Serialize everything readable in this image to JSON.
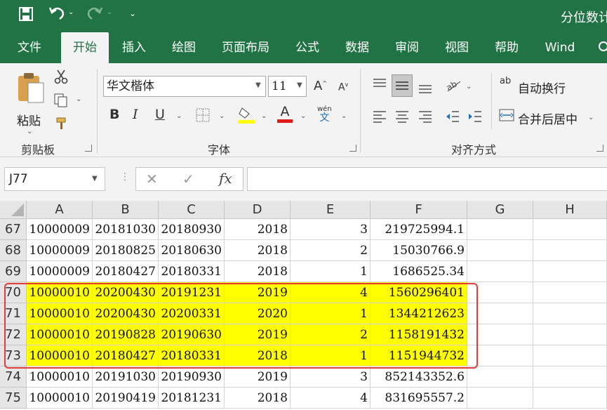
{
  "app": {
    "title": "分位数计"
  },
  "quick_access": {
    "save_icon": "save-icon",
    "undo_icon": "undo-icon",
    "redo_icon": "redo-icon",
    "customize_icon": "customize-qat-icon"
  },
  "tabs": [
    "文件",
    "开始",
    "插入",
    "绘图",
    "页面布局",
    "公式",
    "数据",
    "审阅",
    "视图",
    "帮助",
    "Wind"
  ],
  "active_tab": "开始",
  "ribbon": {
    "clipboard": {
      "paste_label": "粘贴",
      "group_label": "剪贴板"
    },
    "font": {
      "font_name": "华文楷体",
      "font_size": "11",
      "group_label": "字体",
      "bold": "B",
      "italic": "I",
      "underline": "U",
      "font_color_letter": "A",
      "grow_letter": "A",
      "shrink_letter": "A",
      "phonetic_top": "wén",
      "phonetic_bottom": "文",
      "highlight_color": "#ffff00",
      "font_color": "#e01b1b"
    },
    "alignment": {
      "wrap_text": "自动换行",
      "merge_center": "合并后居中",
      "group_label": "对齐方式",
      "wrap_glyph": "ab"
    }
  },
  "formula_bar": {
    "name_box": "J77",
    "cancel": "✕",
    "enter": "✓",
    "fx": "fx",
    "value": ""
  },
  "grid": {
    "columns": [
      "A",
      "B",
      "C",
      "D",
      "E",
      "F",
      "G",
      "H"
    ],
    "rows": [
      {
        "num": "67",
        "cells": [
          "10000009",
          "20181030",
          "20180930",
          "2018",
          "3",
          "219725994.1",
          "",
          ""
        ],
        "highlight": false
      },
      {
        "num": "68",
        "cells": [
          "10000009",
          "20180825",
          "20180630",
          "2018",
          "2",
          "15030766.9",
          "",
          ""
        ],
        "highlight": false
      },
      {
        "num": "69",
        "cells": [
          "10000009",
          "20180427",
          "20180331",
          "2018",
          "1",
          "1686525.34",
          "",
          ""
        ],
        "highlight": false
      },
      {
        "num": "70",
        "cells": [
          "10000010",
          "20200430",
          "20191231",
          "2019",
          "4",
          "1560296401",
          "",
          ""
        ],
        "highlight": true
      },
      {
        "num": "71",
        "cells": [
          "10000010",
          "20200430",
          "20200331",
          "2020",
          "1",
          "1344212623",
          "",
          ""
        ],
        "highlight": true
      },
      {
        "num": "72",
        "cells": [
          "10000010",
          "20190828",
          "20190630",
          "2019",
          "2",
          "1158191432",
          "",
          ""
        ],
        "highlight": true
      },
      {
        "num": "73",
        "cells": [
          "10000010",
          "20180427",
          "20180331",
          "2018",
          "1",
          "1151944732",
          "",
          ""
        ],
        "highlight": true
      },
      {
        "num": "74",
        "cells": [
          "10000010",
          "20191030",
          "20190930",
          "2019",
          "3",
          "852143352.6",
          "",
          ""
        ],
        "highlight": false
      },
      {
        "num": "75",
        "cells": [
          "10000010",
          "20190419",
          "20181231",
          "2018",
          "4",
          "831695557.2",
          "",
          ""
        ],
        "highlight": false
      }
    ],
    "highlight_color": "#ffff00",
    "selection_border_color": "#e23b3b"
  }
}
